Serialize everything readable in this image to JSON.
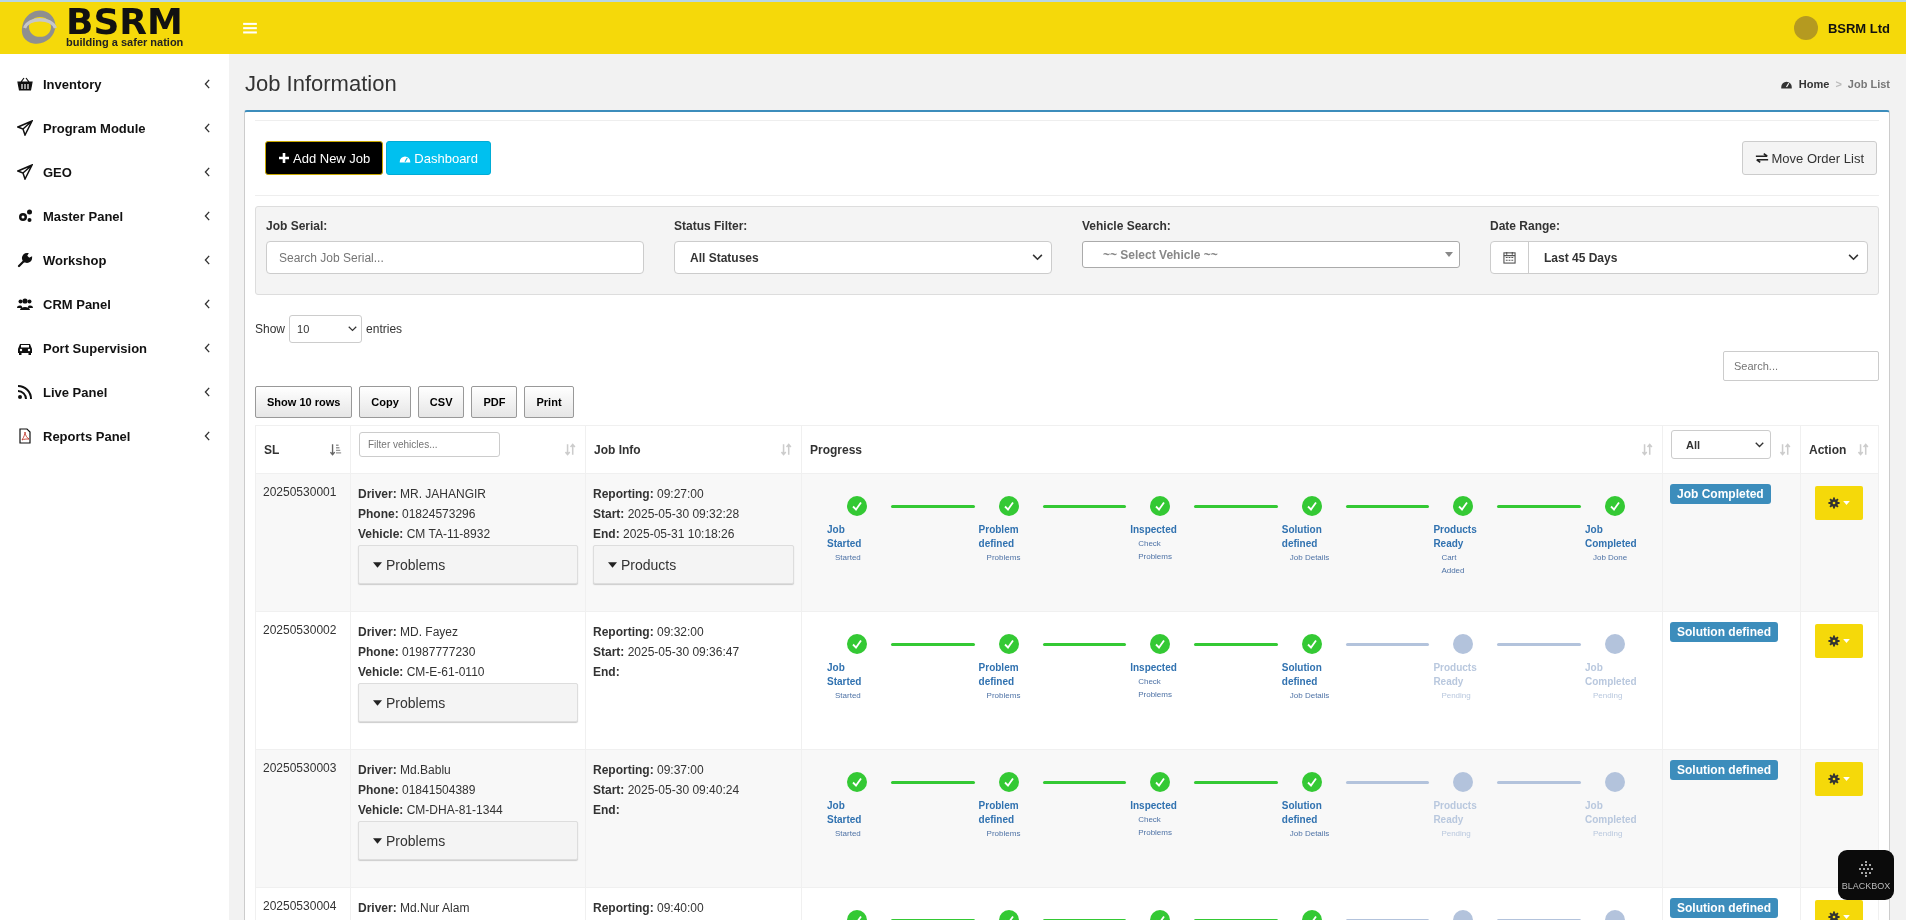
{
  "header": {
    "logo_name": "BSRM",
    "logo_tagline": "building a safer nation",
    "user": "BSRM Ltd"
  },
  "sidebar": {
    "items": [
      {
        "label": "Inventory"
      },
      {
        "label": "Program Module"
      },
      {
        "label": "GEO"
      },
      {
        "label": "Master Panel"
      },
      {
        "label": "Workshop"
      },
      {
        "label": "CRM Panel"
      },
      {
        "label": "Port Supervision"
      },
      {
        "label": "Live Panel"
      },
      {
        "label": "Reports Panel"
      }
    ]
  },
  "page": {
    "title": "Job Information",
    "breadcrumb": [
      "Home",
      "Job List"
    ],
    "breadcrumb_separator": ">"
  },
  "toolbar": {
    "buttons": [
      {
        "kind": "add",
        "label": "Add New Job"
      },
      {
        "kind": "dashboard",
        "label": "Dashboard"
      },
      {
        "kind": "move",
        "label": "Move Order List"
      }
    ]
  },
  "filters": [
    {
      "kind": "input",
      "label": "Job Serial:",
      "placeholder": "Search Job Serial..."
    },
    {
      "kind": "select",
      "label": "Status Filter:",
      "value": "All Statuses"
    },
    {
      "kind": "combo",
      "label": "Vehicle Search:",
      "placeholder": "~~ Select Vehicle ~~"
    },
    {
      "kind": "date",
      "label": "Date Range:",
      "value": "Last 45 Days"
    }
  ],
  "length_menu": {
    "prefix": "Show",
    "value": "10",
    "suffix": "entries"
  },
  "search": {
    "placeholder": "Search..."
  },
  "export_buttons": [
    "Show 10 rows",
    "Copy",
    "CSV",
    "PDF",
    "Print"
  ],
  "table": {
    "columns": [
      {
        "kind": "text",
        "label": "SL",
        "sorted": true
      },
      {
        "kind": "filter",
        "placeholder": "Filter vehicles...",
        "sorted": false
      },
      {
        "kind": "text",
        "label": "Job Info",
        "sorted": false
      },
      {
        "kind": "text",
        "label": "Progress",
        "sorted": false
      },
      {
        "kind": "select",
        "value": "All",
        "sorted": false
      },
      {
        "kind": "text",
        "label": "Action",
        "sorted": false
      }
    ],
    "rows": [
      {
        "sl": "20250530001",
        "vehicle": [
          "**Driver:** MR. JAHANGIR",
          "**Phone:** 01824573296",
          "**Vehicle:** CM TA-11-8932"
        ],
        "vehicle_toggle": "Problems",
        "job_info": [
          "**Reporting:** 09:27:00",
          "**Start:** 2025-05-30 09:32:28",
          "**End:** 2025-05-31 10:18:26"
        ],
        "job_toggle": "Products",
        "status": "Job Completed",
        "steps": [
          {
            "title": "Job Started",
            "sub": "Started",
            "done": true
          },
          {
            "title": "Problem defined",
            "sub": "Problems",
            "done": true
          },
          {
            "title": "Inspected",
            "sub": "Check Problems",
            "done": true
          },
          {
            "title": "Solution defined",
            "sub": "Job Details",
            "done": true
          },
          {
            "title": "Products Ready",
            "sub": "Cart Added",
            "done": true
          },
          {
            "title": "Job Completed",
            "sub": "Job Done",
            "done": true
          }
        ]
      },
      {
        "sl": "20250530002",
        "vehicle": [
          "**Driver:** MD. Fayez",
          "**Phone:** 01987777230",
          "**Vehicle:** CM-E-61-0110"
        ],
        "vehicle_toggle": "Problems",
        "job_info": [
          "**Reporting:** 09:32:00",
          "**Start:** 2025-05-30 09:36:47",
          "**End:**"
        ],
        "status": "Solution defined",
        "steps": [
          {
            "title": "Job Started",
            "sub": "Started",
            "done": true
          },
          {
            "title": "Problem defined",
            "sub": "Problems",
            "done": true
          },
          {
            "title": "Inspected",
            "sub": "Check Problems",
            "done": true
          },
          {
            "title": "Solution defined",
            "sub": "Job Details",
            "done": true
          },
          {
            "title": "Products Ready",
            "sub": "Pending",
            "done": false
          },
          {
            "title": "Job Completed",
            "sub": "Pending",
            "done": false
          }
        ]
      },
      {
        "sl": "20250530003",
        "vehicle": [
          "**Driver:** Md.Bablu",
          "**Phone:** 01841504389",
          "**Vehicle:** CM-DHA-81-1344"
        ],
        "vehicle_toggle": "Problems",
        "job_info": [
          "**Reporting:** 09:37:00",
          "**Start:** 2025-05-30 09:40:24",
          "**End:**"
        ],
        "status": "Solution defined",
        "steps": [
          {
            "title": "Job Started",
            "sub": "Started",
            "done": true
          },
          {
            "title": "Problem defined",
            "sub": "Problems",
            "done": true
          },
          {
            "title": "Inspected",
            "sub": "Check Problems",
            "done": true
          },
          {
            "title": "Solution defined",
            "sub": "Job Details",
            "done": true
          },
          {
            "title": "Products Ready",
            "sub": "Pending",
            "done": false
          },
          {
            "title": "Job Completed",
            "sub": "Pending",
            "done": false
          }
        ]
      },
      {
        "sl": "20250530004",
        "vehicle": [
          "**Driver:** Md.Nur Alam"
        ],
        "job_info": [
          "**Reporting:** 09:40:00"
        ],
        "status": "Solution defined",
        "steps": [
          {
            "done": true
          },
          {
            "done": true
          },
          {
            "done": true
          },
          {
            "done": true
          },
          {
            "done": false
          },
          {
            "done": false
          }
        ]
      }
    ]
  },
  "widget": {
    "label": "BLACKBOX"
  }
}
